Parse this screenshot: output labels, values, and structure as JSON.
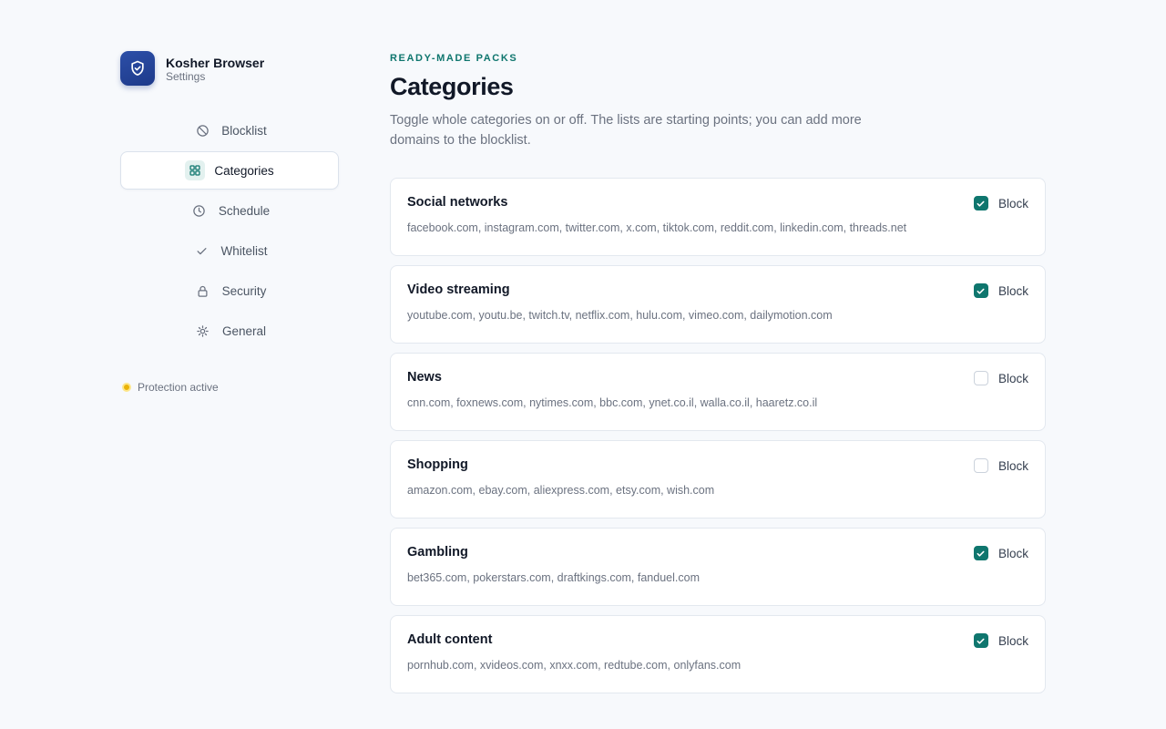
{
  "brand": {
    "name": "Kosher Browser",
    "subtitle": "Settings",
    "logo_icon": "shield-check-icon"
  },
  "nav": {
    "items": [
      {
        "label": "Blocklist",
        "icon": "ban-icon",
        "active": false
      },
      {
        "label": "Categories",
        "icon": "grid-icon",
        "active": true
      },
      {
        "label": "Schedule",
        "icon": "clock-icon",
        "active": false
      },
      {
        "label": "Whitelist",
        "icon": "check-icon",
        "active": false
      },
      {
        "label": "Security",
        "icon": "lock-icon",
        "active": false
      },
      {
        "label": "General",
        "icon": "sun-gear-icon",
        "active": false
      }
    ]
  },
  "status": {
    "text": "Protection active",
    "color": "#eab308"
  },
  "header": {
    "eyebrow": "READY-MADE PACKS",
    "title": "Categories",
    "description": "Toggle whole categories on or off. The lists are starting points; you can add more domains to the blocklist."
  },
  "categories": [
    {
      "name": "Social networks",
      "domains": "facebook.com, instagram.com, twitter.com, x.com, tiktok.com, reddit.com, linkedin.com, threads.net",
      "block_label": "Block",
      "blocked": true
    },
    {
      "name": "Video streaming",
      "domains": "youtube.com, youtu.be, twitch.tv, netflix.com, hulu.com, vimeo.com, dailymotion.com",
      "block_label": "Block",
      "blocked": true
    },
    {
      "name": "News",
      "domains": "cnn.com, foxnews.com, nytimes.com, bbc.com, ynet.co.il, walla.co.il, haaretz.co.il",
      "block_label": "Block",
      "blocked": false
    },
    {
      "name": "Shopping",
      "domains": "amazon.com, ebay.com, aliexpress.com, etsy.com, wish.com",
      "block_label": "Block",
      "blocked": false
    },
    {
      "name": "Gambling",
      "domains": "bet365.com, pokerstars.com, draftkings.com, fanduel.com",
      "block_label": "Block",
      "blocked": true
    },
    {
      "name": "Adult content",
      "domains": "pornhub.com, xvideos.com, xnxx.com, redtube.com, onlyfans.com",
      "block_label": "Block",
      "blocked": true
    }
  ],
  "colors": {
    "accent": "#0f766e",
    "brand": "#1e3a8a",
    "background": "#f7f9fc"
  }
}
